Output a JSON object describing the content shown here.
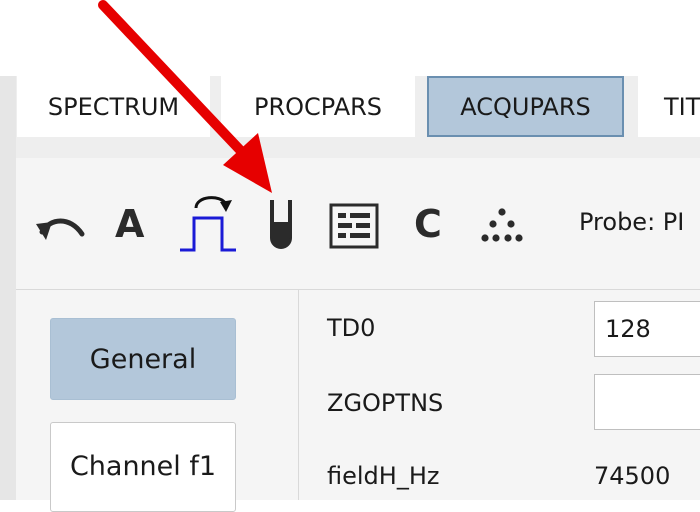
{
  "tabs": [
    {
      "label": "SPECTRUM",
      "active": false
    },
    {
      "label": "PROCPARS",
      "active": false
    },
    {
      "label": "ACQUPARS",
      "active": true
    },
    {
      "label": "TIT",
      "active": false
    }
  ],
  "toolbar": {
    "letter_a": "A",
    "letter_c": "C",
    "probe_label": "Probe: PI",
    "icons": [
      "undo-icon",
      "pulse-sequence-icon",
      "sample-tube-icon",
      "parameter-table-icon",
      "dots-triangle-icon"
    ]
  },
  "nav": {
    "general_label": "General",
    "channel_label": "Channel f1"
  },
  "params": {
    "td0_label": "TD0",
    "td0_value": "128",
    "zgoptns_label": "ZGOPTNS",
    "zgoptns_value": "",
    "fieldh_label": "fieldH_Hz",
    "fieldh_value": "74500"
  },
  "colors": {
    "active_tab": "#b3c7da",
    "annotation_arrow": "#e60000",
    "pulse_icon": "#1a1ad6"
  }
}
